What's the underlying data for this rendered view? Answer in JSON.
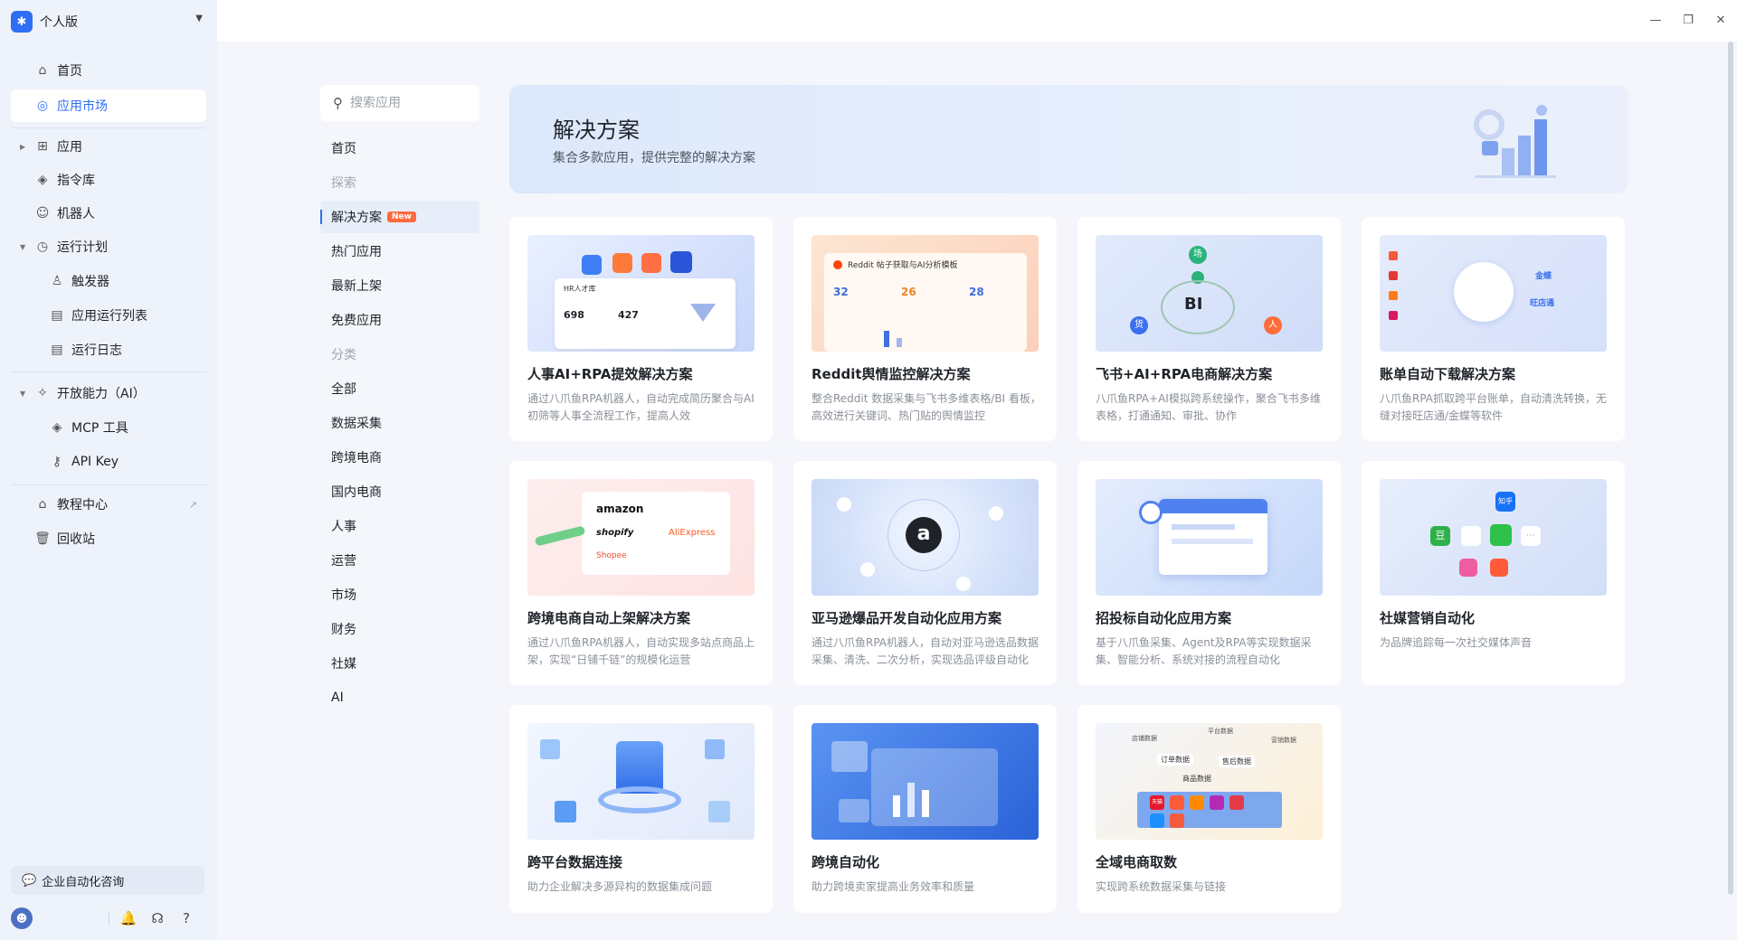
{
  "workspace": {
    "name": "个人版",
    "logo": "app-logo"
  },
  "sidebar": {
    "items": [
      {
        "label": "首页",
        "icon": "home-icon"
      },
      {
        "label": "应用市场",
        "icon": "compass-icon"
      },
      {
        "label": "应用",
        "icon": "grid-icon"
      },
      {
        "label": "指令库",
        "icon": "layers-icon"
      },
      {
        "label": "机器人",
        "icon": "robot-icon"
      },
      {
        "label": "运行计划",
        "icon": "clock-icon"
      },
      {
        "label": "触发器",
        "icon": "user-icon"
      },
      {
        "label": "应用运行列表",
        "icon": "document-icon"
      },
      {
        "label": "运行日志",
        "icon": "document-icon"
      },
      {
        "label": "开放能力（AI）",
        "icon": "sparkle-icon"
      },
      {
        "label": "MCP 工具",
        "icon": "diamond-icon"
      },
      {
        "label": "API Key",
        "icon": "key-icon"
      },
      {
        "label": "教程中心",
        "icon": "graduation-cap-icon"
      },
      {
        "label": "回收站",
        "icon": "trash-icon"
      }
    ],
    "active_index": 1,
    "consult_label": "企业自动化咨询"
  },
  "search": {
    "placeholder": "搜索应用"
  },
  "categories": [
    {
      "label": "首页"
    },
    {
      "label": "探索",
      "header": true
    },
    {
      "label": "解决方案",
      "badge": "New",
      "active": true
    },
    {
      "label": "热门应用"
    },
    {
      "label": "最新上架"
    },
    {
      "label": "免费应用"
    },
    {
      "label": "分类",
      "header": true
    },
    {
      "label": "全部"
    },
    {
      "label": "数据采集"
    },
    {
      "label": "跨境电商"
    },
    {
      "label": "国内电商"
    },
    {
      "label": "人事"
    },
    {
      "label": "运营"
    },
    {
      "label": "市场"
    },
    {
      "label": "财务"
    },
    {
      "label": "社媒"
    },
    {
      "label": "AI"
    }
  ],
  "banner": {
    "title": "解决方案",
    "subtitle": "集合多款应用，提供完整的解决方案"
  },
  "cards": [
    {
      "title": "人事AI+RPA提效解决方案",
      "desc": "通过八爪鱼RPA机器人，自动完成简历聚合与AI初筛等人事全流程工作，提高人效",
      "thumb": {
        "labels": [
          "HR人才库",
          "698",
          "427"
        ]
      }
    },
    {
      "title": "Reddit舆情监控解决方案",
      "desc": "整合Reddit 数据采集与飞书多维表格/BI 看板，高效进行关键词、热门贴的舆情监控",
      "thumb": {
        "labels": [
          "Reddit 帖子获取与AI分析模板",
          "32",
          "26",
          "28"
        ]
      }
    },
    {
      "title": "飞书+AI+RPA电商解决方案",
      "desc": "八爪鱼RPA+AI模拟跨系统操作，聚合飞书多维表格，打通通知、审批、协作",
      "thumb": {
        "labels": [
          "BI",
          "场",
          "货",
          "人"
        ]
      }
    },
    {
      "title": "账单自动下载解决方案",
      "desc": "八爪鱼RPA抓取跨平台账单，自动清洗转换，无缝对接旺店通/金蝶等软件",
      "thumb": {
        "labels": [
          "金蝶",
          "旺店通"
        ]
      }
    },
    {
      "title": "跨境电商自动上架解决方案",
      "desc": "通过八爪鱼RPA机器人，自动实现多站点商品上架，实现“日铺千链”的规模化运营",
      "thumb": {
        "labels": [
          "amazon",
          "shopify",
          "AliExpress",
          "Shopee"
        ]
      }
    },
    {
      "title": "亚马逊爆品开发自动化应用方案",
      "desc": "通过八爪鱼RPA机器人，自动对亚马逊选品数据采集、清洗、二次分析，实现选品评级自动化",
      "thumb": {
        "labels": [
          "a"
        ]
      }
    },
    {
      "title": "招投标自动化应用方案",
      "desc": "基于八爪鱼采集、Agent及RPA等实现数据采集、智能分析、系统对接的流程自动化",
      "thumb": {
        "labels": []
      }
    },
    {
      "title": "社媒营销自动化",
      "desc": "为品牌追踪每一次社交媒体声音",
      "thumb": {
        "labels": [
          "知乎",
          "豆"
        ]
      }
    },
    {
      "title": "跨平台数据连接",
      "desc": "助力企业解决多源异构的数据集成问题",
      "thumb": {
        "labels": []
      }
    },
    {
      "title": "跨境自动化",
      "desc": "助力跨境卖家提高业务效率和质量",
      "thumb": {
        "labels": []
      }
    },
    {
      "title": "全域电商取数",
      "desc": "实现跨系统数据采集与链接",
      "thumb": {
        "labels": [
          "店铺数据",
          "平台数据",
          "营销数据",
          "订单数据",
          "售后数据",
          "商品数据",
          "天猫"
        ]
      }
    }
  ],
  "colors": {
    "accent": "#2e6ef5",
    "badge": "#ff6b3d",
    "sidebar_bg": "#eef2fa",
    "page_bg": "#f4f6fb"
  }
}
